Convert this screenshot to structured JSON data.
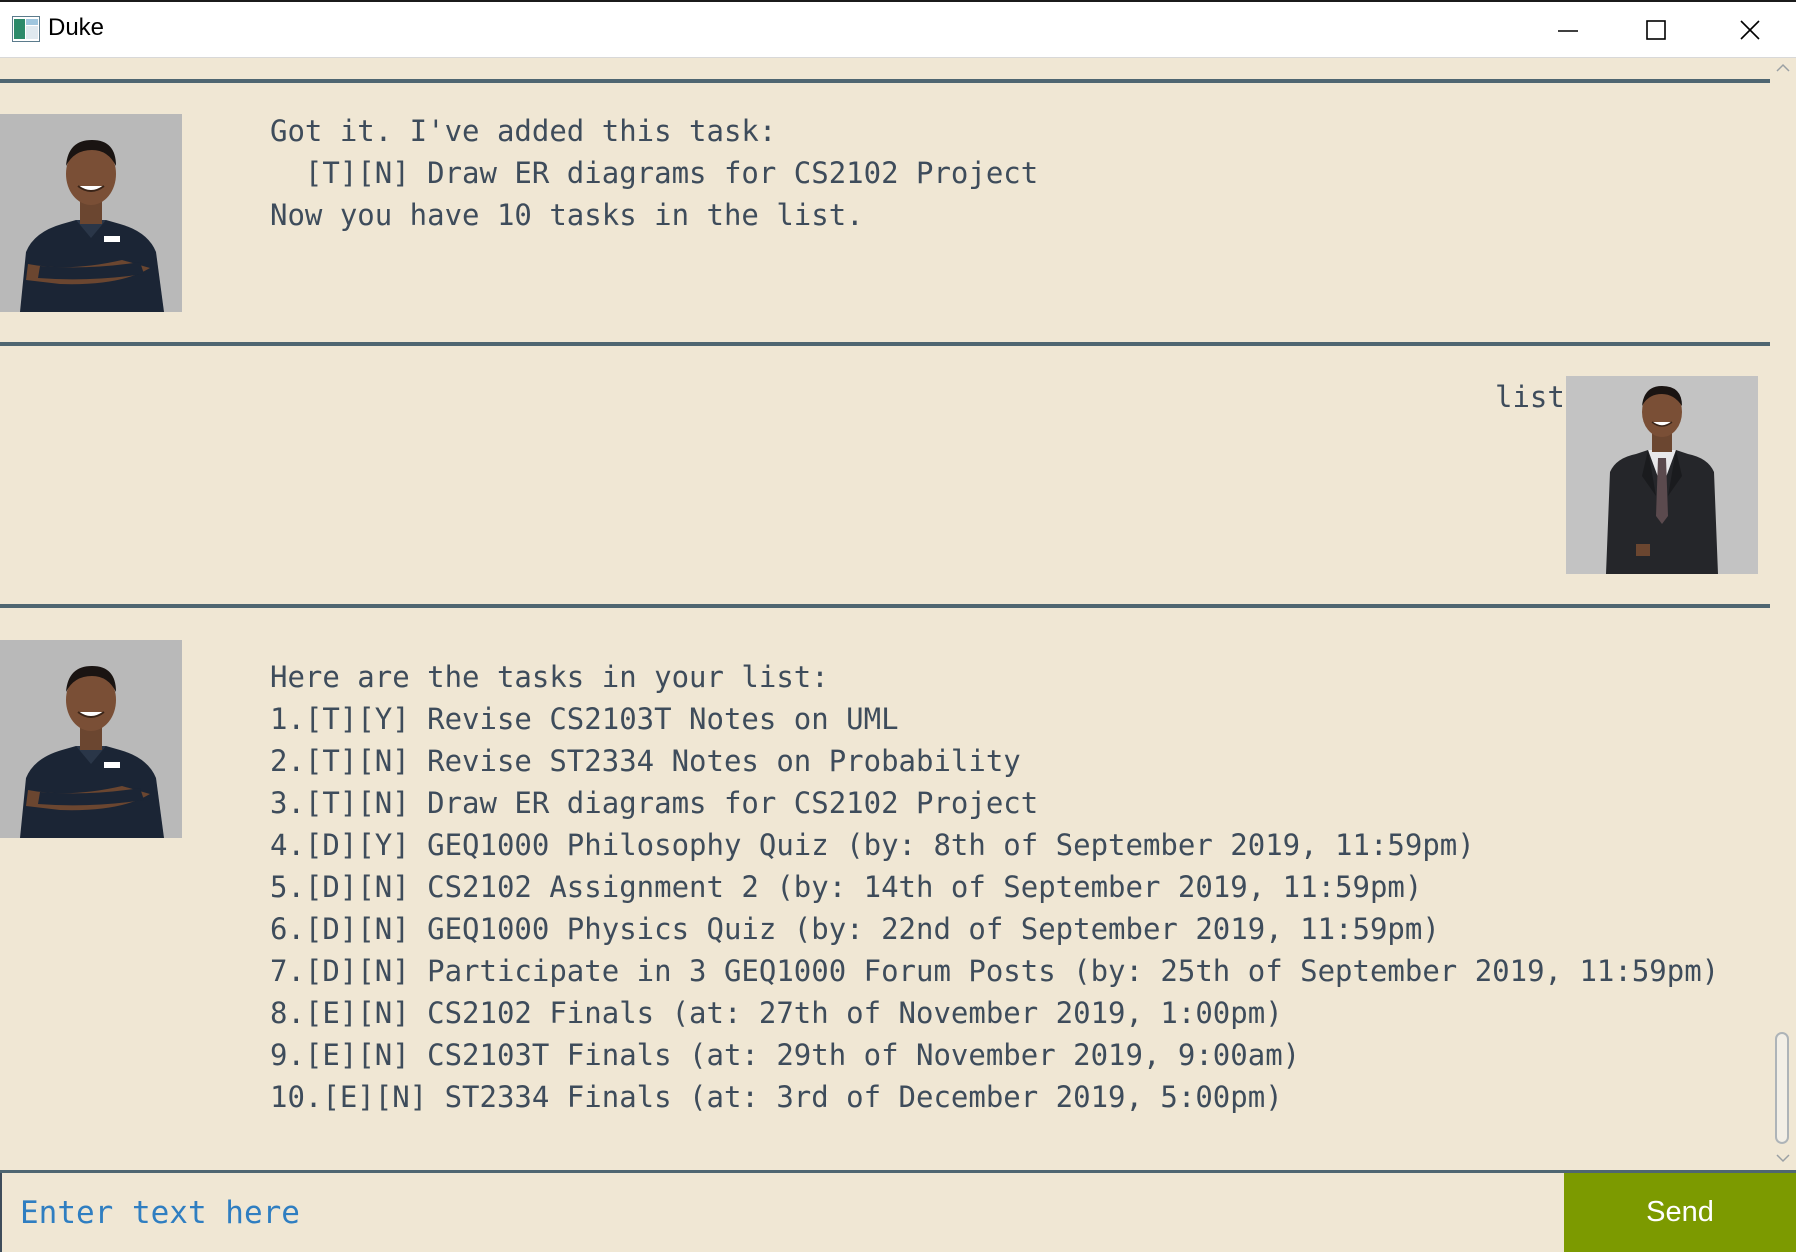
{
  "window": {
    "title": "Duke"
  },
  "messages": [
    {
      "sender": "duke",
      "lines": [
        "Got it. I've added this task:",
        "  [T][N] Draw ER diagrams for CS2102 Project",
        "Now you have 10 tasks in the list."
      ]
    },
    {
      "sender": "user",
      "text": "list"
    },
    {
      "sender": "duke",
      "lines": [
        "Here are the tasks in your list:",
        "1.[T][Y] Revise CS2103T Notes on UML",
        "2.[T][N] Revise ST2334 Notes on Probability",
        "3.[T][N] Draw ER diagrams for CS2102 Project",
        "4.[D][Y] GEQ1000 Philosophy Quiz (by: 8th of September 2019, 11:59pm)",
        "5.[D][N] CS2102 Assignment 2 (by: 14th of September 2019, 11:59pm)",
        "6.[D][N] GEQ1000 Physics Quiz (by: 22nd of September 2019, 11:59pm)",
        "7.[D][N] Participate in 3 GEQ1000 Forum Posts (by: 25th of September 2019, 11:59pm)",
        "8.[E][N] CS2102 Finals (at: 27th of November 2019, 1:00pm)",
        "9.[E][N] CS2103T Finals (at: 29th of November 2019, 9:00am)",
        "10.[E][N] ST2334 Finals (at: 3rd of December 2019, 5:00pm)"
      ]
    }
  ],
  "input": {
    "placeholder": "Enter text here",
    "value": "",
    "send_label": "Send"
  },
  "colors": {
    "background": "#f0e7d4",
    "divider": "#4f6671",
    "text": "#3e4c5b",
    "placeholder": "#2f7ec1",
    "send_button": "#7c9a00"
  },
  "icons": {
    "app": "duke-app-icon",
    "minimize": "minimize-icon",
    "maximize": "maximize-icon",
    "close": "close-icon"
  }
}
